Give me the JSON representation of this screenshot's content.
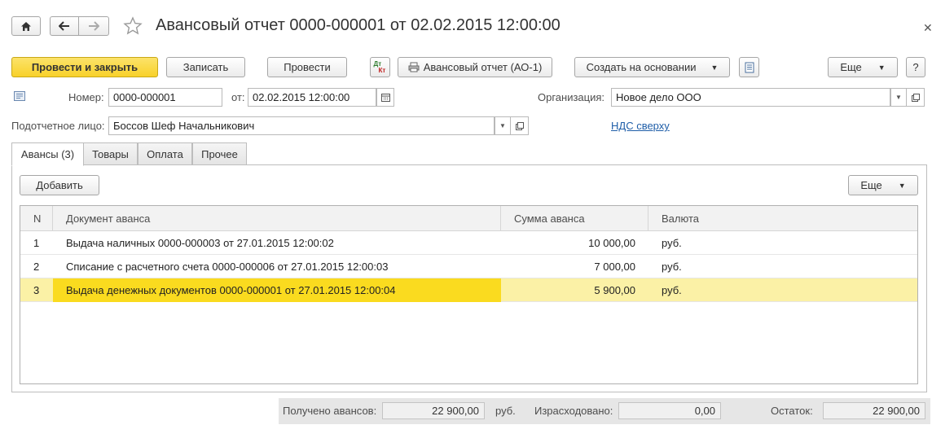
{
  "window": {
    "title": "Авансовый отчет 0000-000001 от 02.02.2015 12:00:00",
    "home_icon": "home-icon",
    "back_icon": "arrow-left-icon",
    "forward_icon": "arrow-right-icon",
    "favorite_icon": "star-icon",
    "close_icon": "close-icon"
  },
  "toolbar": {
    "post_and_close": "Провести и закрыть",
    "save": "Записать",
    "post": "Провести",
    "dt_kt_icon": "dt-kt-icon",
    "dt_label": "Дт",
    "kt_label": "Кт",
    "print_label": "Авансовый отчет (АО-1)",
    "create_based_on": "Создать на основании",
    "more": "Еще",
    "help": "?"
  },
  "header": {
    "number_label": "Номер:",
    "number_value": "0000-000001",
    "date_label": "от:",
    "date_value": "02.02.2015 12:00:00",
    "org_label": "Организация:",
    "org_value": "Новое дело ООО",
    "person_label": "Подотчетное лицо:",
    "person_value": "Боссов Шеф Начальникович",
    "vat_link": "НДС сверху"
  },
  "tabs": [
    {
      "label": "Авансы (3)",
      "active": true
    },
    {
      "label": "Товары",
      "active": false
    },
    {
      "label": "Оплата",
      "active": false
    },
    {
      "label": "Прочее",
      "active": false
    }
  ],
  "panel": {
    "add_button": "Добавить",
    "more_button": "Еще"
  },
  "table": {
    "columns": [
      "N",
      "Документ аванса",
      "Сумма аванса",
      "Валюта"
    ],
    "rows": [
      {
        "n": "1",
        "doc": "Выдача наличных 0000-000003 от 27.01.2015 12:00:02",
        "sum": "10 000,00",
        "currency": "руб.",
        "selected": false
      },
      {
        "n": "2",
        "doc": "Списание с расчетного счета 0000-000006 от 27.01.2015 12:00:03",
        "sum": "7 000,00",
        "currency": "руб.",
        "selected": false
      },
      {
        "n": "3",
        "doc": "Выдача денежных документов 0000-000001 от 27.01.2015 12:00:04",
        "sum": "5 900,00",
        "currency": "руб.",
        "selected": true
      }
    ]
  },
  "footer": {
    "received_label": "Получено авансов:",
    "received_value": "22 900,00",
    "received_currency": "руб.",
    "spent_label": "Израсходовано:",
    "spent_value": "0,00",
    "balance_label": "Остаток:",
    "balance_value": "22 900,00"
  },
  "colors": {
    "accent_yellow": "#f8d12a",
    "selected_row": "#fbf1a6",
    "selected_cell": "#fadb1f",
    "link": "#1f5ea8"
  }
}
